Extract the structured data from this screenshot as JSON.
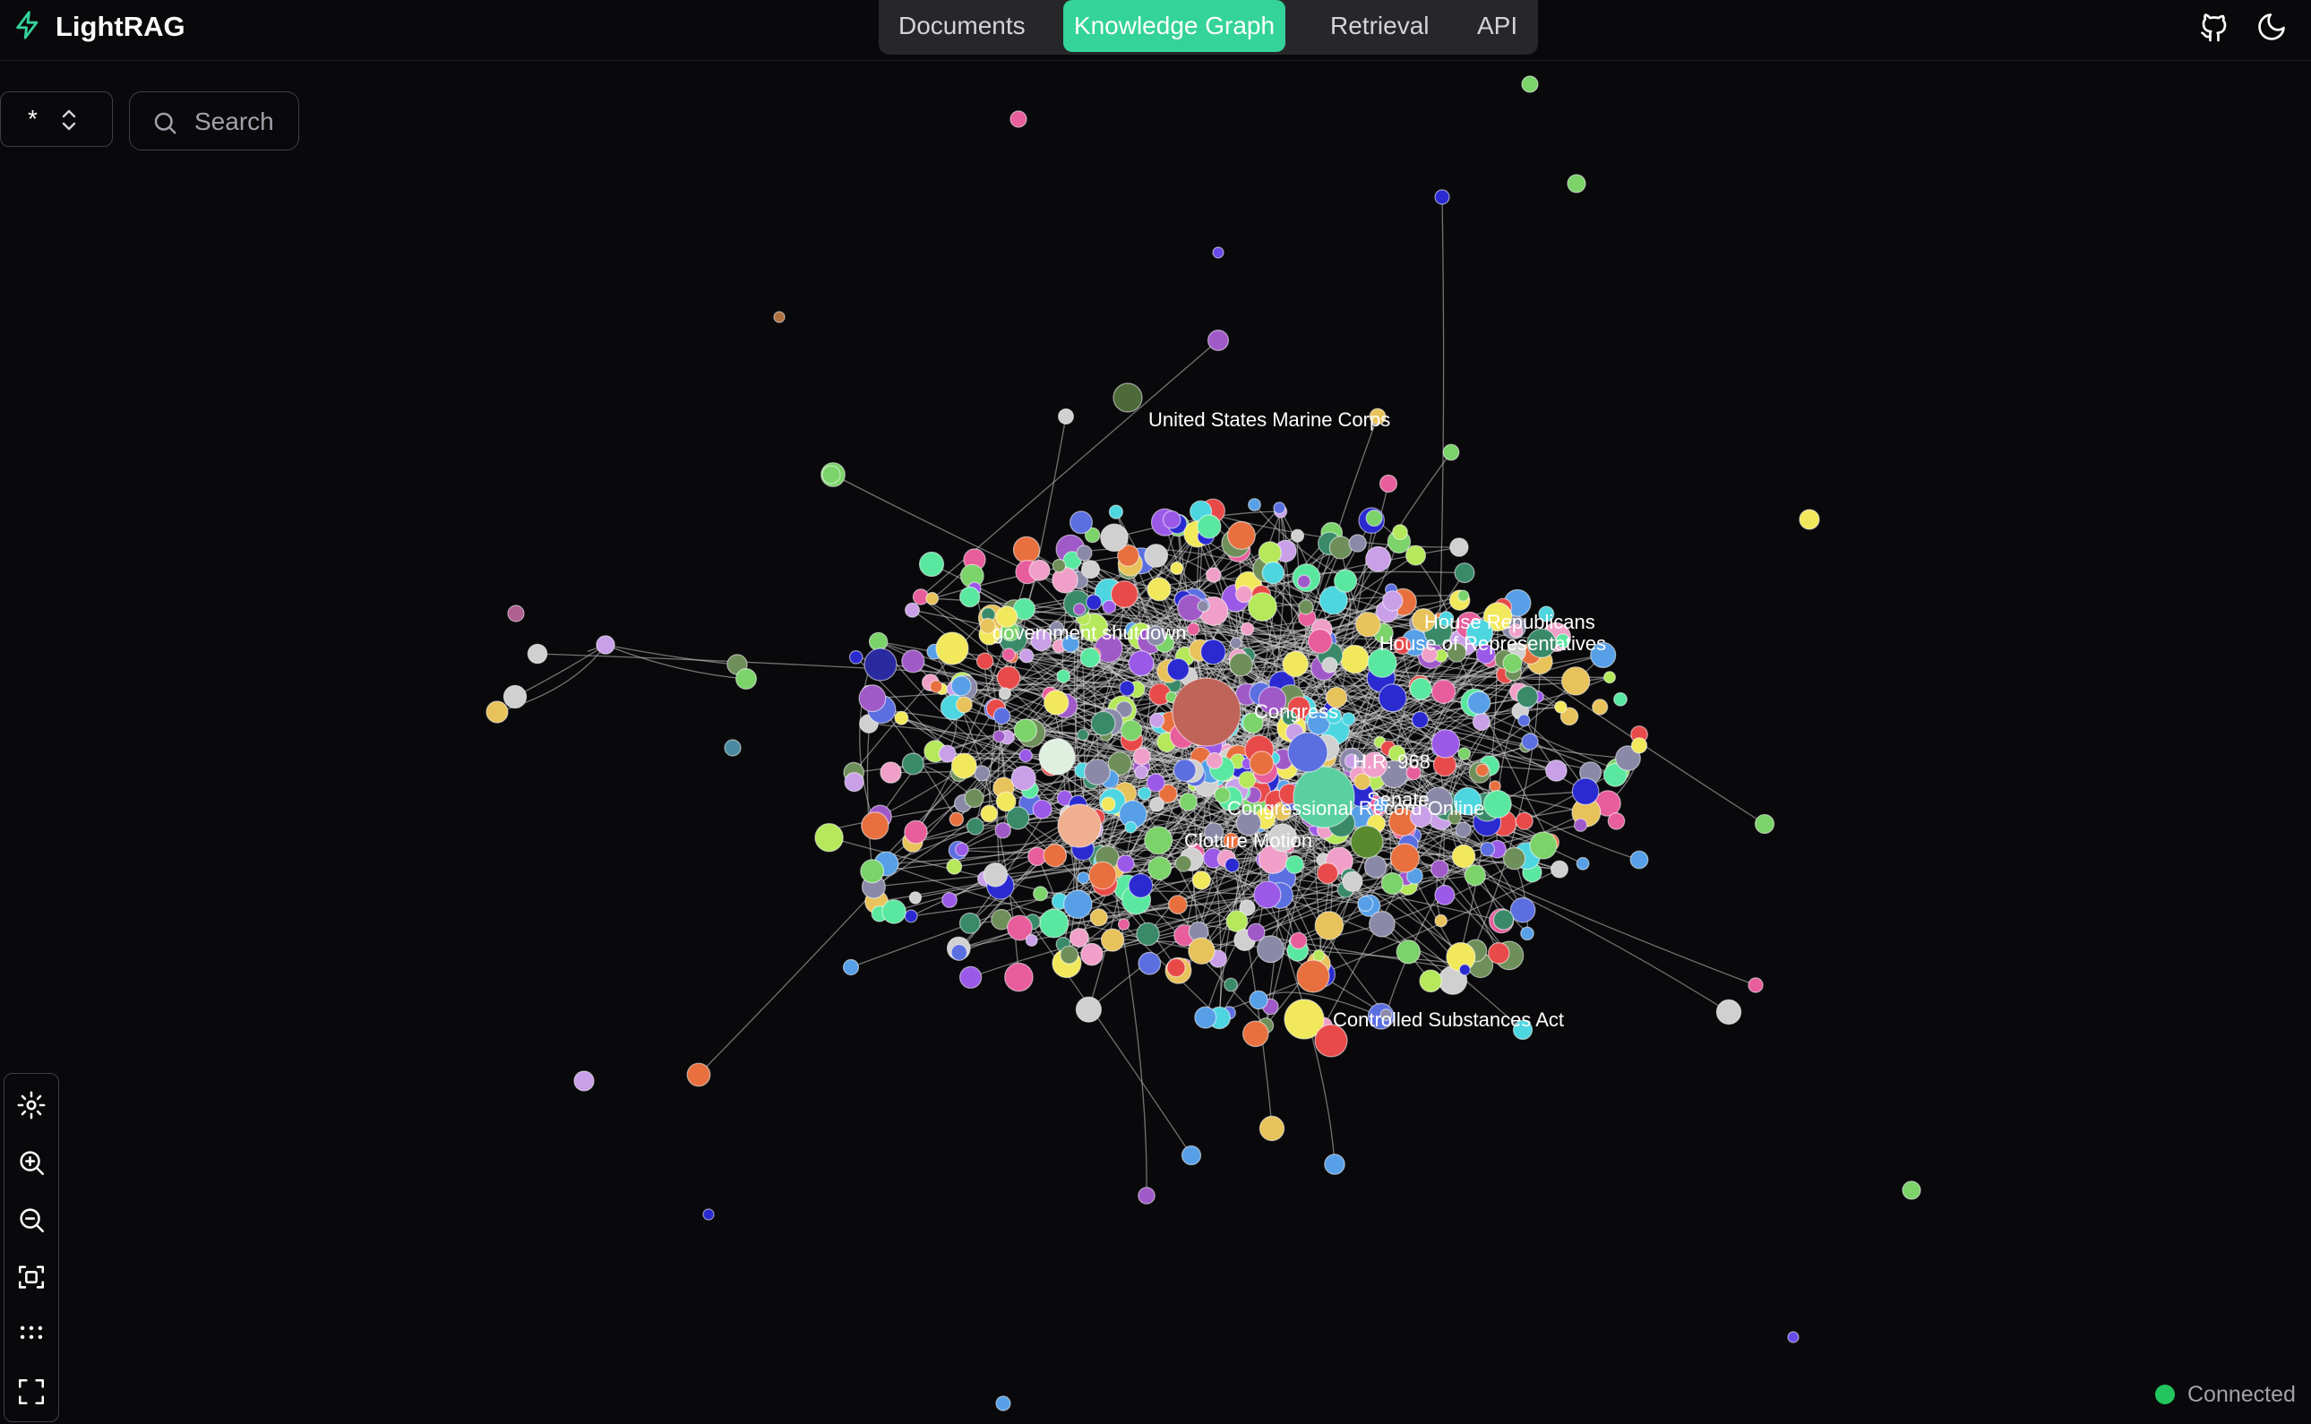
{
  "app": {
    "name": "LightRAG",
    "accent_color": "#34d399",
    "icons": {
      "logo": "zap-icon",
      "github": "github-icon",
      "theme": "moon-icon"
    }
  },
  "nav": {
    "tabs": [
      {
        "label": "Documents",
        "active": false
      },
      {
        "label": "Knowledge Graph",
        "active": true
      },
      {
        "label": "Retrieval",
        "active": false
      },
      {
        "label": "API",
        "active": false
      }
    ]
  },
  "graph_controls": {
    "label_filter_value": "*",
    "search_placeholder": "Search"
  },
  "graph": {
    "labels": [
      "United States Marine Corps",
      "government shutdown",
      "House Republicans",
      "House of Representatives",
      "Congress",
      "H.R. 968",
      "Senate",
      "Congressional Record Online",
      "Cloture Motion",
      "Controlled Substances Act"
    ]
  },
  "toolbar": {
    "tools": [
      "settings-icon",
      "zoom-in-icon",
      "zoom-out-icon",
      "fit-view-icon",
      "layout-grid-icon",
      "fullscreen-icon"
    ]
  },
  "status": {
    "text": "Connected",
    "color": "#22c55e"
  }
}
